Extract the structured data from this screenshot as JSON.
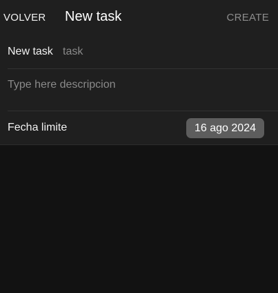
{
  "header": {
    "back_label": "VOLVER",
    "title": "New task",
    "create_label": "CREATE"
  },
  "form": {
    "name_label": "New task",
    "name_value": "",
    "name_placeholder": "task",
    "description_value": "",
    "description_placeholder": "Type here descripcion",
    "due_date_label": "Fecha limite",
    "due_date_value": "16 ago 2024"
  },
  "colors": {
    "background": "#121212",
    "surface": "#1f1f1f",
    "date_chip": "#5d5d5d",
    "disabled_text": "#8d8d8d"
  }
}
